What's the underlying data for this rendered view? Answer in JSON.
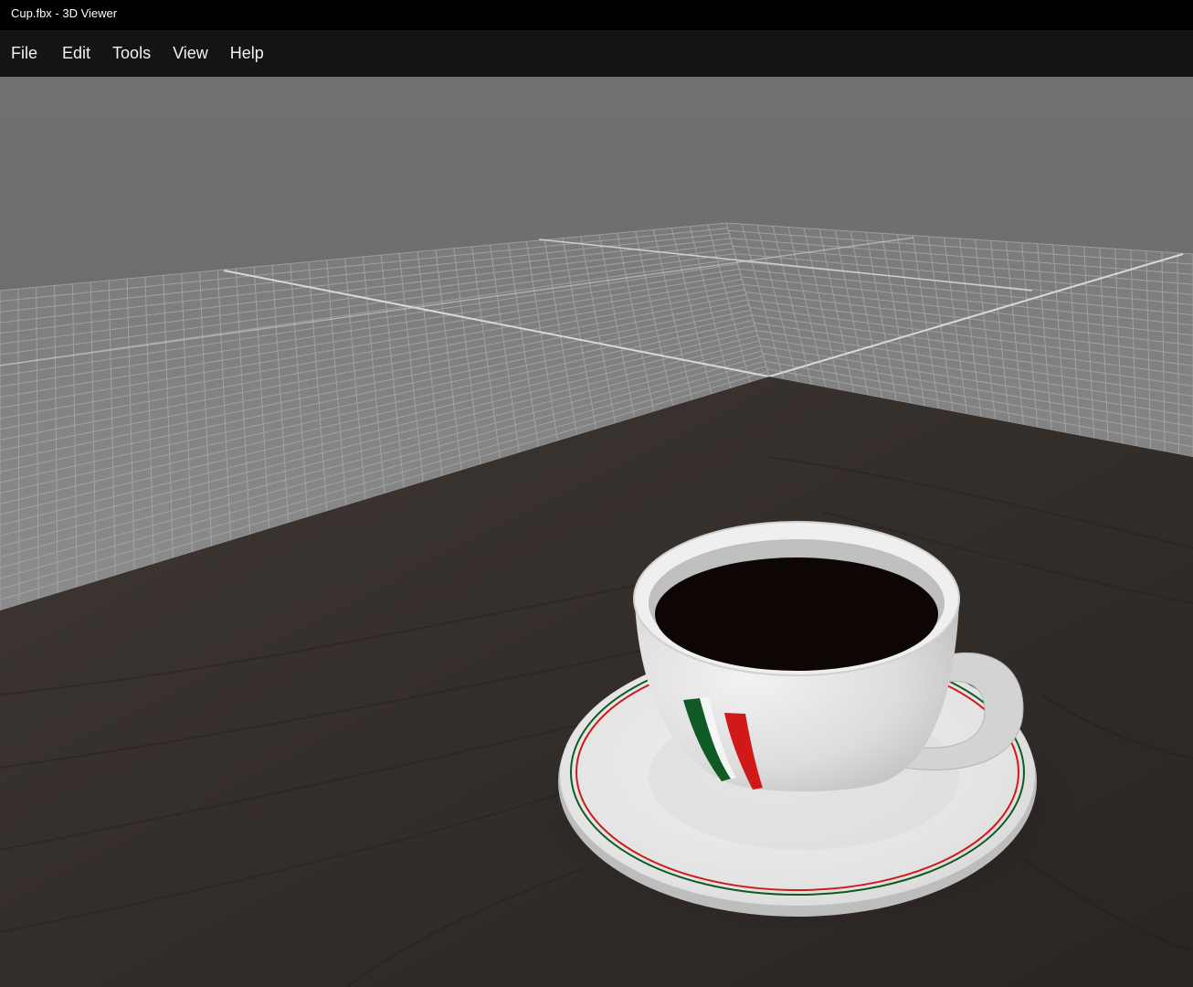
{
  "window": {
    "title": "Cup.fbx - 3D Viewer"
  },
  "menu": {
    "items": [
      {
        "label": "File"
      },
      {
        "label": "Edit"
      },
      {
        "label": "Tools"
      },
      {
        "label": "View"
      },
      {
        "label": "Help"
      }
    ]
  },
  "viewport": {
    "model": "coffee-cup-with-saucer",
    "background_color": "#6b6b6b",
    "grid_color": "#9a9a9a",
    "table_color": "#3a3430",
    "coffee_color": "#0e0605",
    "stripe_colors": [
      "#0f5a25",
      "#d01a1a"
    ]
  }
}
